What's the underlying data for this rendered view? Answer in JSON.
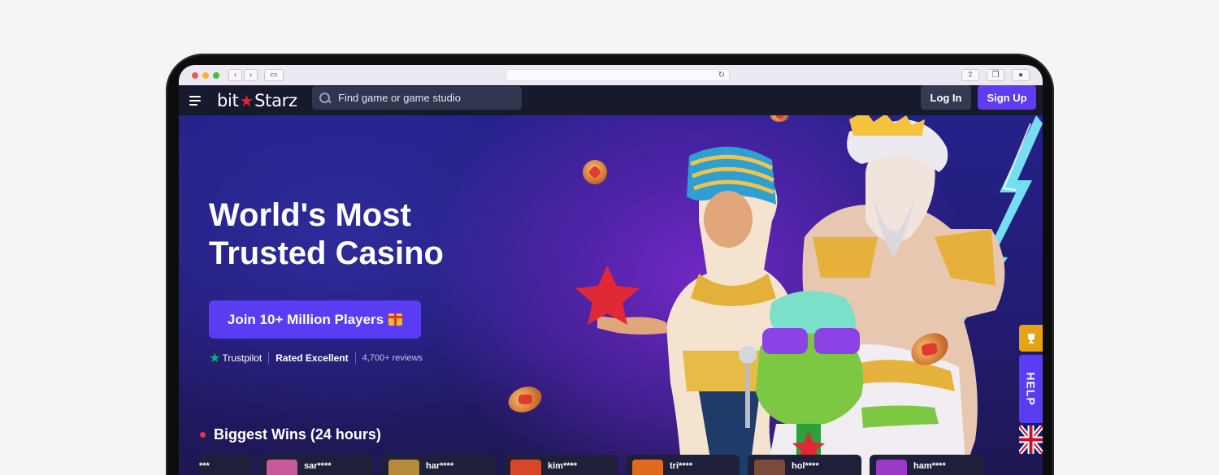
{
  "browser": {
    "reload_icon": "↻",
    "traffic_colors": [
      "#f05a52",
      "#f5b52e",
      "#3fc242"
    ]
  },
  "header": {
    "logo_left": "bit",
    "logo_star": "★",
    "logo_right": "Starz",
    "search_placeholder": "Find game or game studio",
    "login_label": "Log In",
    "signup_label": "Sign Up"
  },
  "hero": {
    "title_line1": "World's Most",
    "title_line2": "Trusted Casino",
    "cta_label": "Join 10+ Million Players",
    "trustpilot_label": "Trustpilot",
    "rating_text": "Rated Excellent",
    "reviews_text": "4,700+ reviews"
  },
  "wins": {
    "heading": "Biggest Wins (24 hours)",
    "items": [
      {
        "user": "***",
        "thumb_color": "#2b2f4a"
      },
      {
        "user": "sar****",
        "thumb_color": "#c95a9a"
      },
      {
        "user": "har****",
        "thumb_color": "#b58a3a"
      },
      {
        "user": "kim****",
        "thumb_color": "#d8462a"
      },
      {
        "user": "tri****",
        "thumb_color": "#e26a1c"
      },
      {
        "user": "hol****",
        "thumb_color": "#7a4a3a"
      },
      {
        "user": "ham****",
        "thumb_color": "#9a3ac8"
      }
    ]
  },
  "side": {
    "help_label": "HELP",
    "trophy_icon": "trophy",
    "flag": "uk-flag"
  },
  "colors": {
    "brand_purple": "#5f3cf0",
    "brand_red": "#e51f38",
    "header_bg": "#161a2c"
  }
}
